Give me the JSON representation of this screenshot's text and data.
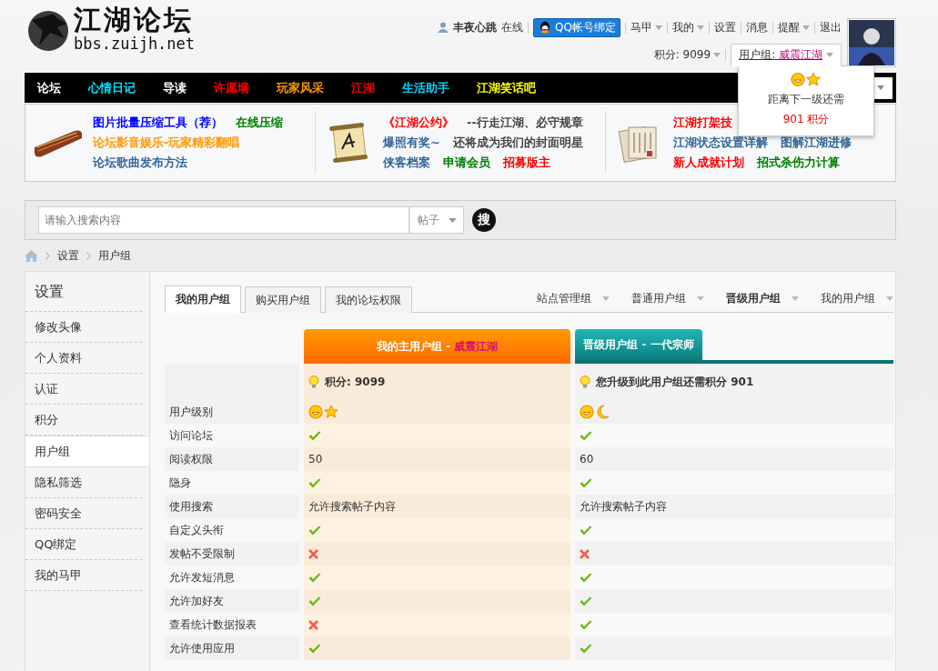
{
  "header": {
    "logo": {
      "title": "江湖论坛",
      "url": "bbs.zuijh.net"
    },
    "user": {
      "name": "丰夜心跳",
      "status": "在线"
    },
    "qq_button": "QQ帐号绑定",
    "menu": [
      {
        "label": "马甲",
        "dropdown": true
      },
      {
        "label": "我的",
        "dropdown": true
      },
      {
        "label": "设置",
        "dropdown": false
      },
      {
        "label": "消息",
        "dropdown": false
      },
      {
        "label": "提醒",
        "dropdown": true
      },
      {
        "label": "退出",
        "dropdown": false
      }
    ],
    "points": "积分: 9099",
    "usergroup": {
      "label": "用户组:",
      "name": "威震江湖",
      "expanded": true
    },
    "popup": {
      "text": "距离下一级还需",
      "points": "901 积分"
    }
  },
  "nav": [
    {
      "label": "论坛",
      "color": "#ffffff"
    },
    {
      "label": "心情日记",
      "color": "#00e5ff"
    },
    {
      "label": "导读",
      "color": "#ffffff"
    },
    {
      "label": "许愿墙",
      "color": "#ff0000"
    },
    {
      "label": "玩家风采",
      "color": "#ff9900"
    },
    {
      "label": "江湖",
      "color": "#ff0000"
    },
    {
      "label": "生活助手",
      "color": "#00d5ff"
    },
    {
      "label": "江湖笑话吧",
      "color": "#ffff00"
    }
  ],
  "promos": [
    {
      "kind": "instrument",
      "lines": [
        [
          {
            "text": "图片批量压缩工具（荐）",
            "color": "#0000ff"
          },
          {
            "text": "在线压缩",
            "color": "#008000"
          }
        ],
        [
          {
            "text": "论坛影音娱乐-玩家精彩翻唱",
            "color": "#ff9900"
          }
        ],
        [
          {
            "text": "论坛歌曲发布方法",
            "color": "#336699"
          }
        ]
      ]
    },
    {
      "kind": "scroll",
      "lines": [
        [
          {
            "text": "《江湖公约》",
            "color": "#ff0000"
          },
          {
            "text": "--行走江湖、必守规章",
            "color": "#444444"
          }
        ],
        [
          {
            "text": "爆照有奖~",
            "color": "#336699"
          },
          {
            "text": "还将成为我们的封面明星",
            "color": "#444444"
          }
        ],
        [
          {
            "text": "侠客档案",
            "color": "#336699"
          },
          {
            "text": "申请会员",
            "color": "#008000"
          },
          {
            "text": "招募版主",
            "color": "#ff0000"
          }
        ]
      ]
    },
    {
      "kind": "papers",
      "lines": [
        [
          {
            "text": "江湖打架技",
            "color": "#ff0000"
          }
        ],
        [
          {
            "text": "江湖状态设置详解",
            "color": "#336699"
          },
          {
            "text": "图解江湖进修",
            "color": "#336699"
          }
        ],
        [
          {
            "text": "新人成就计划",
            "color": "#ff0000"
          },
          {
            "text": "招式杀伤力计算",
            "color": "#008000"
          }
        ]
      ]
    }
  ],
  "search": {
    "placeholder": "请输入搜索内容",
    "scope": "帖子",
    "button": "搜"
  },
  "breadcrumb": [
    "设置",
    "用户组"
  ],
  "sidebar": {
    "title": "设置",
    "items": [
      {
        "label": "修改头像",
        "selected": false
      },
      {
        "label": "个人资料",
        "selected": false
      },
      {
        "label": "认证",
        "selected": false
      },
      {
        "label": "积分",
        "selected": false
      },
      {
        "label": "用户组",
        "selected": true
      },
      {
        "label": "隐私筛选",
        "selected": false
      },
      {
        "label": "密码安全",
        "selected": false
      },
      {
        "label": "QQ绑定",
        "selected": false
      },
      {
        "label": "我的马甲",
        "selected": false
      }
    ]
  },
  "tabs": [
    {
      "label": "我的用户组",
      "selected": true
    },
    {
      "label": "购买用户组",
      "selected": false
    },
    {
      "label": "我的论坛权限",
      "selected": false
    }
  ],
  "group_links": [
    {
      "label": "站点管理组",
      "selected": false
    },
    {
      "label": "普通用户组",
      "selected": false
    },
    {
      "label": "晋级用户组",
      "selected": true
    },
    {
      "label": "我的用户组",
      "selected": false
    }
  ],
  "table": {
    "columns": [
      {
        "kind": "main",
        "title": "我的主用户组 -",
        "group": "威震江湖",
        "summary": "积分: 9099"
      },
      {
        "kind": "upgrade",
        "title": "晋级用户组 - 一代宗师",
        "summary": "您升级到此用户组还需积分 901"
      }
    ],
    "rows": [
      {
        "label": "用户级别",
        "cells": [
          {
            "kind": "star"
          },
          {
            "kind": "moon"
          }
        ]
      },
      {
        "label": "访问论坛",
        "cells": [
          {
            "kind": "yes"
          },
          {
            "kind": "yes"
          }
        ]
      },
      {
        "label": "阅读权限",
        "cells": [
          {
            "kind": "text",
            "text": "50"
          },
          {
            "kind": "text",
            "text": "60"
          }
        ]
      },
      {
        "label": "隐身",
        "cells": [
          {
            "kind": "yes"
          },
          {
            "kind": "yes"
          }
        ]
      },
      {
        "label": "使用搜索",
        "cells": [
          {
            "kind": "text",
            "text": "允许搜索帖子内容"
          },
          {
            "kind": "text",
            "text": "允许搜索帖子内容"
          }
        ]
      },
      {
        "label": "自定义头衔",
        "cells": [
          {
            "kind": "yes"
          },
          {
            "kind": "yes"
          }
        ]
      },
      {
        "label": "发帖不受限制",
        "cells": [
          {
            "kind": "no"
          },
          {
            "kind": "no"
          }
        ]
      },
      {
        "label": "允许发短消息",
        "cells": [
          {
            "kind": "yes"
          },
          {
            "kind": "yes"
          }
        ]
      },
      {
        "label": "允许加好友",
        "cells": [
          {
            "kind": "yes"
          },
          {
            "kind": "yes"
          }
        ]
      },
      {
        "label": "查看统计数据报表",
        "cells": [
          {
            "kind": "no"
          },
          {
            "kind": "yes"
          }
        ]
      },
      {
        "label": "允许使用应用",
        "cells": [
          {
            "kind": "yes"
          },
          {
            "kind": "yes"
          }
        ]
      }
    ]
  }
}
